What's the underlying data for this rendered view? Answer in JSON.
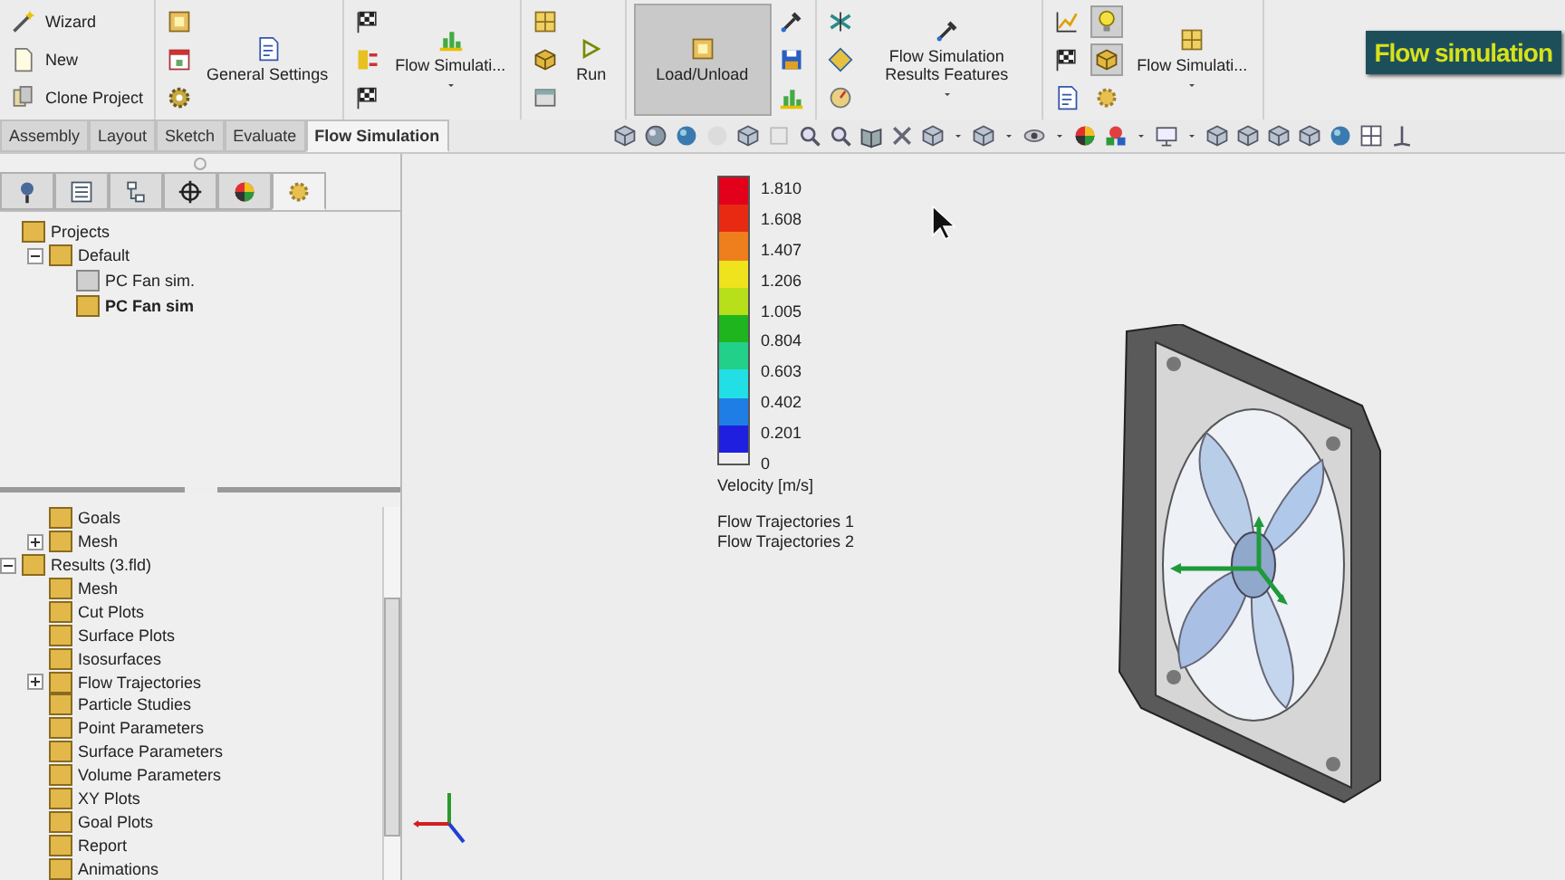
{
  "ribbon": {
    "groups": [
      {
        "kind": "list",
        "items": [
          "Wizard",
          "New",
          "Clone Project"
        ]
      },
      {
        "kind": "large",
        "label": "General Settings",
        "dropdown": false,
        "pressed": false
      },
      {
        "kind": "large",
        "label": "Flow Simulati...",
        "dropdown": true,
        "pressed": false
      },
      {
        "kind": "run",
        "label": "Run"
      },
      {
        "kind": "large",
        "label": "Load/Unload",
        "dropdown": false,
        "pressed": true
      },
      {
        "kind": "large",
        "label": "Flow Simulation Results Features",
        "dropdown": true,
        "pressed": false
      },
      {
        "kind": "large",
        "label": "Flow Simulati...",
        "dropdown": true,
        "pressed": false,
        "toggles": [
          {
            "pressed": true
          },
          {
            "pressed": true
          },
          {
            "pressed": false
          }
        ]
      }
    ],
    "badge": "Flow simulation"
  },
  "tabs": [
    {
      "label": "Assembly",
      "selected": false
    },
    {
      "label": "Layout",
      "selected": false
    },
    {
      "label": "Sketch",
      "selected": false
    },
    {
      "label": "Evaluate",
      "selected": false
    },
    {
      "label": "Flow Simulation",
      "selected": true
    }
  ],
  "panel_tabs": [
    {
      "selected": false
    },
    {
      "selected": false
    },
    {
      "selected": false
    },
    {
      "selected": false
    },
    {
      "selected": false
    },
    {
      "selected": true
    }
  ],
  "project_tree": [
    {
      "label": "Projects",
      "children": [
        {
          "label": "Default",
          "expanded": true,
          "children": [
            {
              "label": "PC Fan sim.",
              "active": false
            },
            {
              "label": "PC Fan sim",
              "active": true
            }
          ]
        }
      ]
    }
  ],
  "feature_tree": [
    {
      "children": [
        {
          "label": "Goals"
        },
        {
          "label": "Mesh",
          "expanded": false
        }
      ]
    },
    {
      "label": "Results (3.fld)",
      "expanded": true,
      "children": [
        {
          "label": "Mesh"
        },
        {
          "label": "Cut Plots"
        },
        {
          "label": "Surface Plots"
        },
        {
          "label": "Isosurfaces"
        },
        {
          "label": "Flow Trajectories",
          "expanded": false
        },
        {
          "label": "Particle Studies"
        },
        {
          "label": "Point Parameters"
        },
        {
          "label": "Surface Parameters"
        },
        {
          "label": "Volume Parameters"
        },
        {
          "label": "XY Plots"
        },
        {
          "label": "Goal Plots"
        },
        {
          "label": "Report"
        },
        {
          "label": "Animations"
        }
      ]
    }
  ],
  "legend": {
    "bands": [
      {
        "color": "#e3001a"
      },
      {
        "color": "#e82a12"
      },
      {
        "color": "#ef7e1c"
      },
      {
        "color": "#eee31c"
      },
      {
        "color": "#b7e01a"
      },
      {
        "color": "#1fb51f"
      },
      {
        "color": "#23d08a"
      },
      {
        "color": "#22dfe6"
      },
      {
        "color": "#1f7ee6"
      },
      {
        "color": "#1f1fe0"
      }
    ],
    "ticks": [
      "1.810",
      "1.608",
      "1.407",
      "1.206",
      "1.005",
      "0.804",
      "0.603",
      "0.402",
      "0.201",
      "0"
    ],
    "title": "Velocity [m/s]"
  },
  "plots": [
    "Flow Trajectories 1",
    "Flow Trajectories 2"
  ]
}
